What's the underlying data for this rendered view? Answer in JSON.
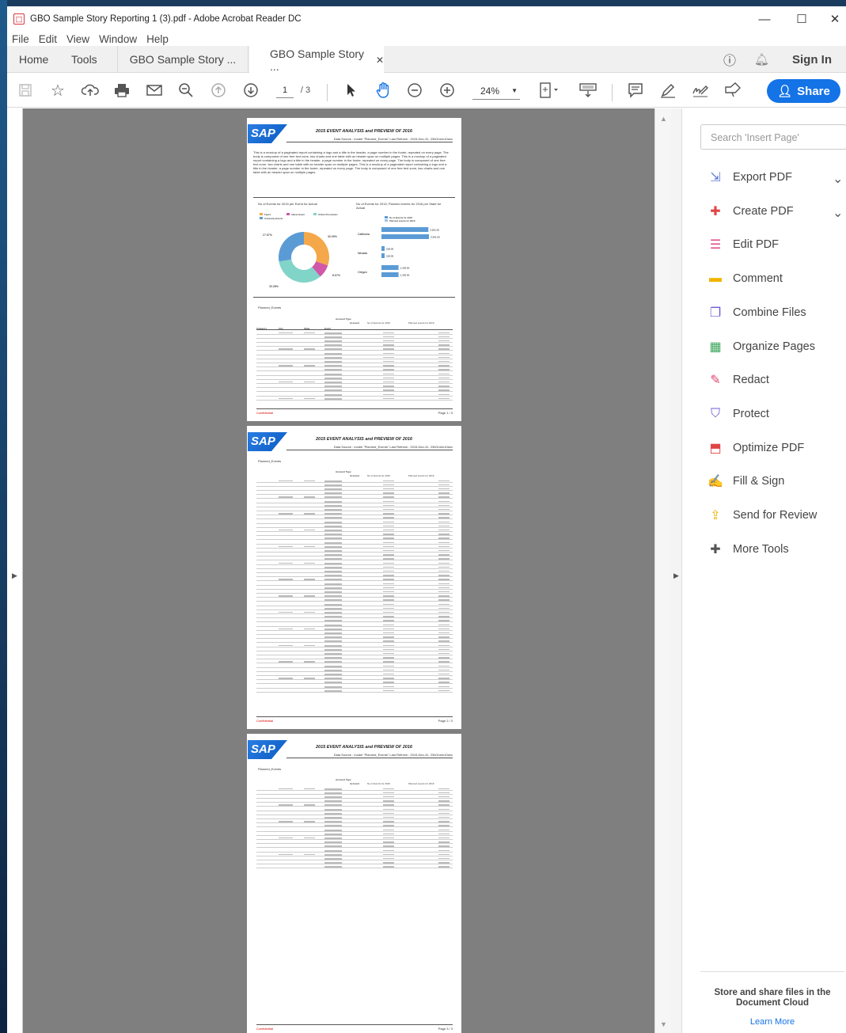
{
  "window": {
    "title": "GBO Sample Story Reporting 1 (3).pdf - Adobe Acrobat Reader DC"
  },
  "menu": [
    "File",
    "Edit",
    "View",
    "Window",
    "Help"
  ],
  "tabs": {
    "home": "Home",
    "tools": "Tools",
    "doc_a": "GBO Sample Story ...",
    "doc_b": "GBO Sample Story ...",
    "sign_in": "Sign In"
  },
  "toolbar": {
    "page_current": "1",
    "page_total": "/ 3",
    "zoom": "24%",
    "share_label": "Share"
  },
  "search": {
    "placeholder": "Search 'Insert Page'"
  },
  "tools_pane": [
    {
      "label": "Export PDF",
      "icon": "export-pdf-icon",
      "color": "#5b7bd5",
      "expandable": true
    },
    {
      "label": "Create PDF",
      "icon": "create-pdf-icon",
      "color": "#e04545",
      "expandable": true
    },
    {
      "label": "Edit PDF",
      "icon": "edit-pdf-icon",
      "color": "#e04587",
      "expandable": false
    },
    {
      "label": "Comment",
      "icon": "comment-icon",
      "color": "#f0b400",
      "expandable": false
    },
    {
      "label": "Combine Files",
      "icon": "combine-files-icon",
      "color": "#6e58d4",
      "expandable": false
    },
    {
      "label": "Organize Pages",
      "icon": "organize-pages-icon",
      "color": "#3aa55a",
      "expandable": false
    },
    {
      "label": "Redact",
      "icon": "redact-icon",
      "color": "#e0456e",
      "expandable": false
    },
    {
      "label": "Protect",
      "icon": "protect-icon",
      "color": "#6e58d4",
      "expandable": false
    },
    {
      "label": "Optimize PDF",
      "icon": "optimize-pdf-icon",
      "color": "#e04545",
      "expandable": false
    },
    {
      "label": "Fill & Sign",
      "icon": "fill-sign-icon",
      "color": "#6e58d4",
      "expandable": false
    },
    {
      "label": "Send for Review",
      "icon": "send-for-review-icon",
      "color": "#f0b400",
      "expandable": false
    },
    {
      "label": "More Tools",
      "icon": "more-tools-icon",
      "color": "#555555",
      "expandable": false
    }
  ],
  "promo": {
    "title": "Store and share files in the Document Cloud",
    "link": "Learn More"
  },
  "report": {
    "logo": "SAP",
    "title": "2015 EVENT ANALYSIS and PREVIEW OF 2016",
    "source": "Data Source : model \"Planned_Events\"     Last Refresh : 2015-Dec-31, 23h01min10sec",
    "body": "This is a mockup of a paginated report containing a logo and a title in the header, a page number in the footer, repeated on every page. The body is composed of one free text zone, two charts and one table with an header span on multiple pages. This is a mockup of a paginated report containing a logo and a title in the header, a page number in the footer, repeated on every page. The body is composed of one free text zone, two charts and one table with an header span on multiple pages. This is a mockup of a paginated report containing a logo and a title in the header, a page number in the footer, repeated on every page. The body is composed of one free text zone, two charts and one table with an header span on multiple pages.",
    "chart1_title": "No of Events for 2015 per Event for Actual",
    "chart2_title": "No of Events for 2015, Planned events for 2016 per State for Actual",
    "table_title": "Planned_Events",
    "account_type": "Account Type",
    "account": "Account",
    "no_events_2015": "No of Events for 2015",
    "planned_2016": "Planned events for 2016",
    "col_category": "Category",
    "col_city": "City",
    "col_state": "State",
    "col_event": "Event",
    "confidential": "Confidential",
    "page1": "Page 1 / 3",
    "page2": "Page 2 / 3",
    "page3": "Page 3 / 3"
  },
  "chart_data": [
    {
      "type": "pie",
      "title": "No of Events for 2015 per Event for Actual",
      "categories": [
        "Flyers",
        "Indoor Event",
        "Online Promotions",
        "University Events"
      ],
      "values": [
        30.09,
        8.57,
        33.28,
        27.57
      ],
      "colors": [
        "#f4a84a",
        "#d157a8",
        "#80d4c8",
        "#5b9bd5"
      ],
      "labels": [
        "27.57%",
        "30.09%",
        "8.57%",
        "33.28%"
      ]
    },
    {
      "type": "bar",
      "title": "No of Events for 2015, Planned events for 2016 per State for Actual",
      "categories": [
        "California",
        "Nevada",
        "Oregon"
      ],
      "series": [
        {
          "name": "No of Events for 2015",
          "values": [
            3251,
            218,
            1183
          ]
        },
        {
          "name": "Planned events for 2016",
          "values": [
            3291,
            218,
            1183
          ]
        }
      ],
      "data_labels": [
        "3,251.00",
        "3,291.00",
        "218.00",
        "218.00",
        "1,183.00",
        "1,183.00"
      ]
    }
  ]
}
